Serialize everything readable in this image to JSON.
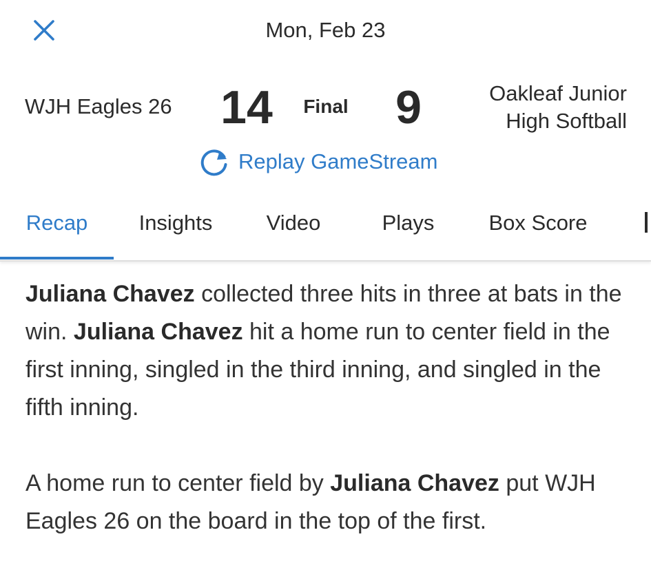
{
  "header": {
    "date": "Mon, Feb 23",
    "close_icon": "close-icon"
  },
  "game": {
    "home_team": "WJH Eagles 26",
    "home_score": "14",
    "status": "Final",
    "away_score": "9",
    "away_team_line1": "Oakleaf Junior",
    "away_team_line2": "High Softball",
    "replay_label": "Replay GameStream",
    "replay_icon": "refresh-icon"
  },
  "tabs": [
    {
      "label": "Recap",
      "active": true
    },
    {
      "label": "Insights",
      "active": false
    },
    {
      "label": "Video",
      "active": false
    },
    {
      "label": "Plays",
      "active": false
    },
    {
      "label": "Box Score",
      "active": false
    }
  ],
  "recap": {
    "p1": {
      "player1": "Juliana Chavez",
      "text1": " collected three hits in three at bats in the win. ",
      "player2": "Juliana Chavez",
      "text2": " hit a home run to center field in the first inning, singled in the third inning, and singled in the fifth inning."
    },
    "p2": {
      "text1": "A home run to center field by ",
      "player": "Juliana Chavez",
      "text2": " put WJH Eagles 26 on the board in the top of the first."
    }
  },
  "colors": {
    "accent": "#2f7cc9",
    "text": "#2b2b2b",
    "divider": "#dedede"
  }
}
